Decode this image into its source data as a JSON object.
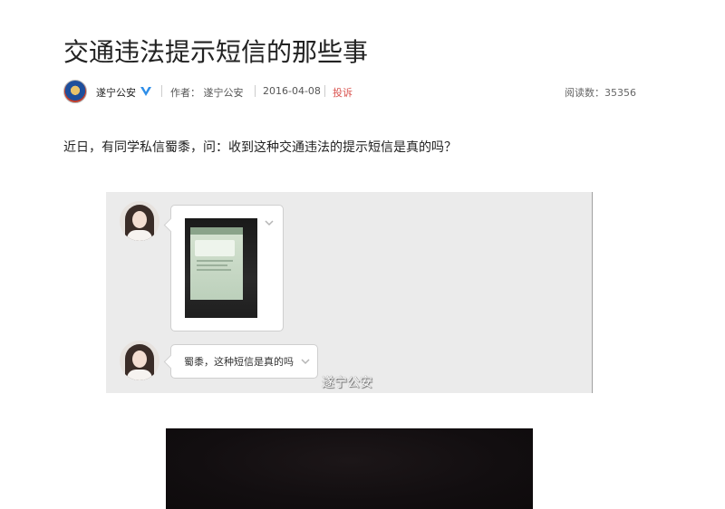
{
  "article": {
    "title": "交通违法提示短信的那些事",
    "intro": "近日，有同学私信蜀黍，问：收到这种交通违法的提示短信是真的吗？"
  },
  "meta": {
    "author": "遂宁公安",
    "byline": "作者： 遂宁公安",
    "date": "2016-04-08",
    "complain_label": "投诉",
    "views": "阅读数：35356",
    "colors": {
      "verified_badge": "#2e8ee8",
      "complain": "#d9534f"
    }
  },
  "chat": {
    "message_text": "蜀黍，这种短信是真的吗",
    "watermark": "遂宁公安",
    "icons": [
      "avatar",
      "chevron-down-icon",
      "photo-thumbnail"
    ]
  }
}
